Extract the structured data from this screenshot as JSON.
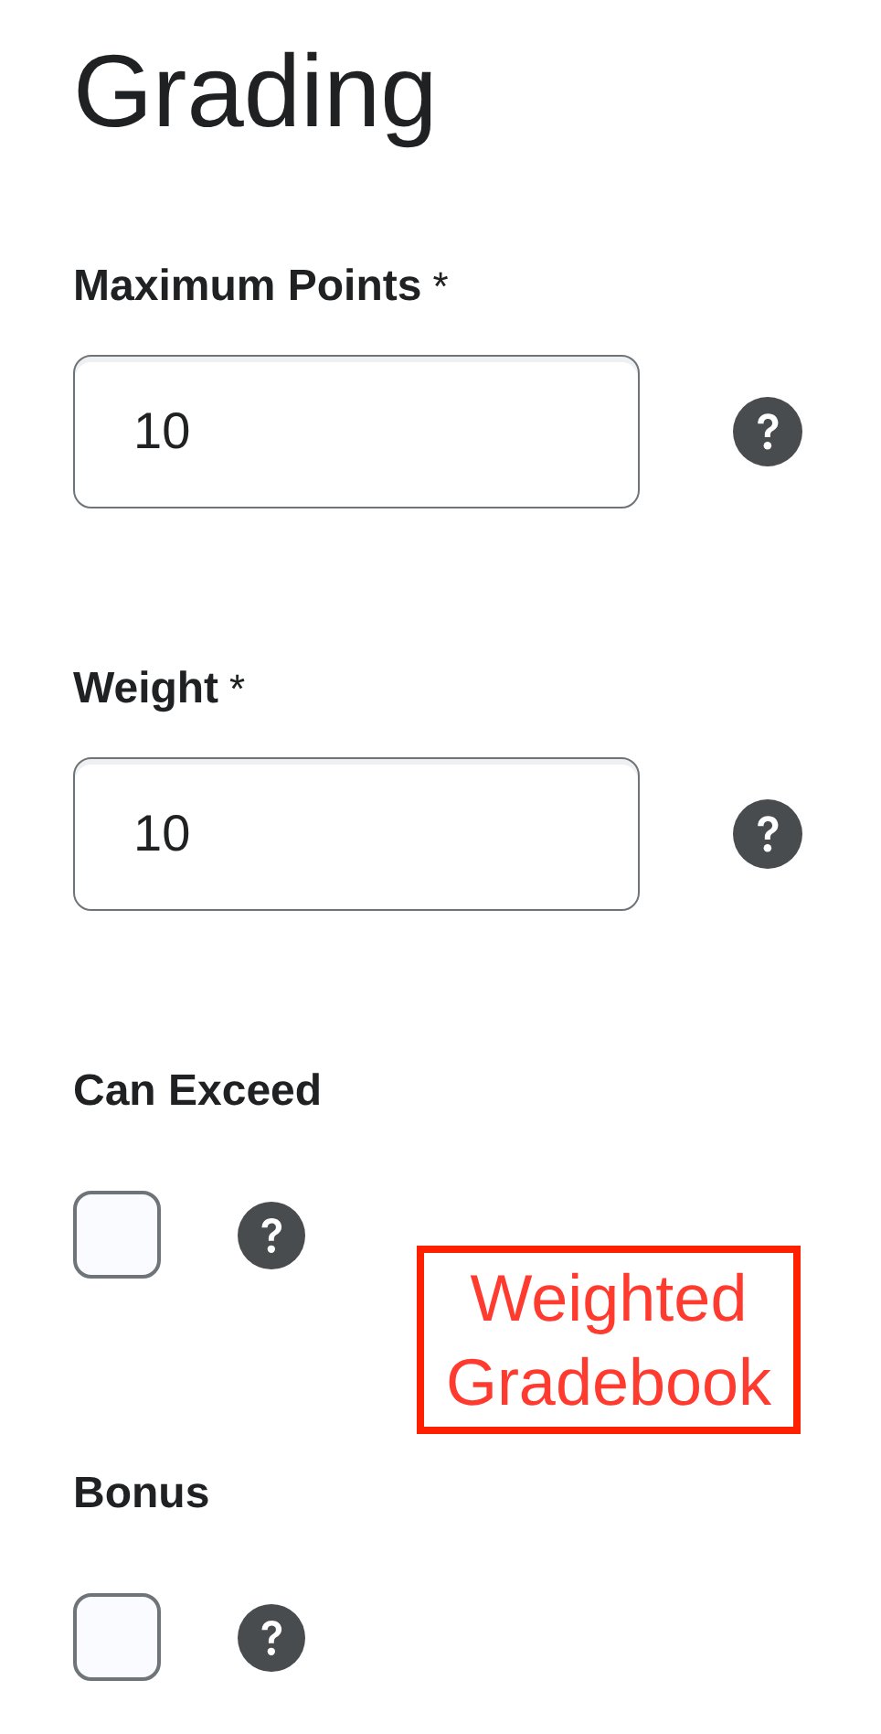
{
  "title": "Grading",
  "fields": [
    {
      "kind": "number",
      "label": "Maximum Points",
      "required_mark": "*",
      "value": "10"
    },
    {
      "kind": "number",
      "label": "Weight",
      "required_mark": "*",
      "value": "10"
    },
    {
      "kind": "checkbox",
      "label": "Can Exceed",
      "checked": false,
      "annotation": "Weighted Gradebook"
    },
    {
      "kind": "checkbox",
      "label": "Bonus",
      "checked": false
    }
  ]
}
